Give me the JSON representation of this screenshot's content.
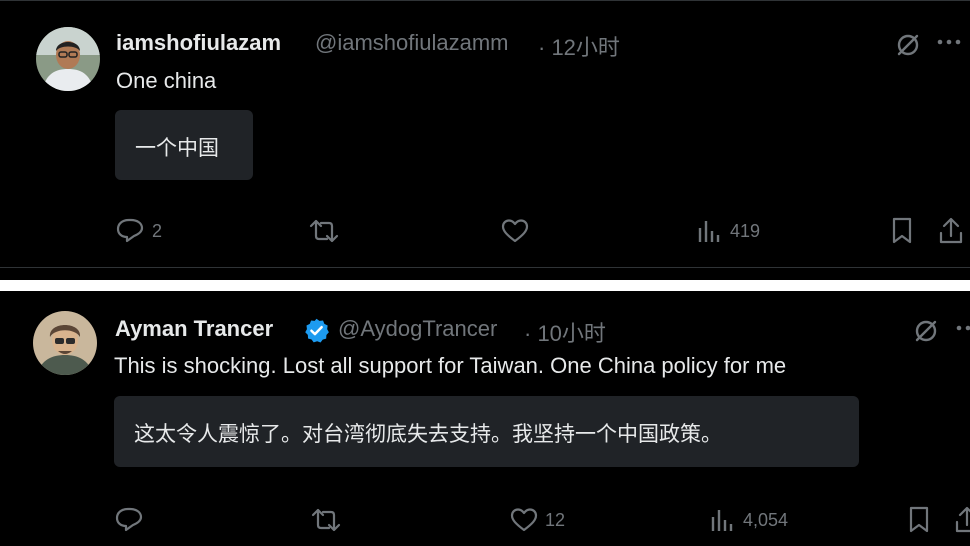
{
  "posts": [
    {
      "display_name": "iamshofiulazam",
      "handle": "@iamshofiulazamm",
      "time": "· 12小时",
      "verified": false,
      "text": "One china",
      "translation": "一个中国",
      "stats": {
        "replies": "2",
        "reposts": "",
        "likes": "",
        "views": "419"
      }
    },
    {
      "display_name": "Ayman Trancer",
      "handle": "@AydogTrancer",
      "time": "· 10小时",
      "verified": true,
      "text": "This is shocking. Lost all support for Taiwan. One China policy for me",
      "translation": "这太令人震惊了。对台湾彻底失去支持。我坚持一个中国政策。",
      "stats": {
        "replies": "",
        "reposts": "",
        "likes": "12",
        "views": "4,054"
      }
    }
  ],
  "icons": {
    "reply": "reply-icon",
    "repost": "repost-icon",
    "like": "heart-icon",
    "views": "views-icon",
    "bookmark": "bookmark-icon",
    "share": "share-icon",
    "grok": "grok-icon",
    "more": "more-icon",
    "verified": "verified-badge-icon"
  },
  "colors": {
    "background": "#000000",
    "text": "#e7e9ea",
    "muted": "#71767b",
    "verified": "#1d9bf0",
    "translation_box": "#202327",
    "divider": "#ffffff"
  }
}
